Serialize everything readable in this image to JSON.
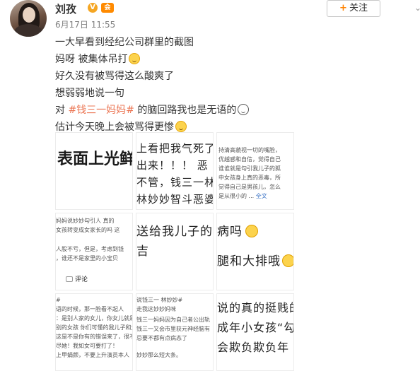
{
  "user": {
    "name": "刘孜",
    "vip_badge": "V",
    "member_badge": "会",
    "timestamp": "6月17日 11:55",
    "avatar_icon": "avatar"
  },
  "follow_button": {
    "plus": "+",
    "label": "关注"
  },
  "menu_icon": "chevron-down-icon",
  "post_lines": [
    {
      "before": "一大早看到经纪公司群里的截图",
      "tag": "",
      "after": ""
    },
    {
      "before": "妈呀 被集体吊打",
      "tag": "",
      "after": ""
    },
    {
      "before": "好久没有被骂得这么酸爽了",
      "tag": "",
      "after": ""
    },
    {
      "before": "想弱弱地说一句",
      "tag": "",
      "after": ""
    },
    {
      "before": "对 ",
      "tag": "#钱三一妈妈#",
      "after": " 的脑回路我也是无语的"
    },
    {
      "before": "估计今天晚上会被骂得更惨",
      "tag": "",
      "after": ""
    }
  ],
  "tiles": {
    "t1": {
      "line1": "表面上光鲜"
    },
    "t2": {
      "line1": "上看把我气死了",
      "line2": "出来！！！ 恶",
      "line3": "不管，钱三一林",
      "line4": "林妙妙智斗恶婆"
    },
    "t3": {
      "line1": "持清高藐视一切的嘴脸，",
      "line2": "优越感和自信，觉得自己",
      "line3": "谁谁就是勾引我儿子的狐",
      "line4": "中女孩身上真的恶毒，所",
      "line5": "觉得自己是男孩儿，怎么",
      "line6": "是从很小的 ...",
      "more": "全文"
    },
    "t4": {
      "line1": "妈妈说妙妙勾引人 真的",
      "line2": "女孩转变成女家长的吗 这",
      "line3": "人股不亏，但是，考虑到钱",
      "line4": "，谁还不是家里的小宝贝",
      "comment": "评论"
    },
    "t5": {
      "line1": "送给我儿子的",
      "line2": "吉"
    },
    "t6": {
      "line1": "病吗",
      "line2": "腿和大排哦"
    },
    "t7": {
      "line1": "#",
      "line2": "语的时候，那一脸看不起人",
      "line3": "：是别人家的女儿，你女儿就是个渣渣",
      "line4": "别的女孩 你们可懂的我儿子和女孩。名",
      "line5": "这是不是你有的错误来了，很不得让女孩妈妈后",
      "line6": "尽她！我如女可要打了！",
      "line7": "上甲娟颜，不要上升演员本人"
    },
    "t8": {
      "line1": "说钱三一 林妙妙#",
      "line2": "走我这妙妙妈咪",
      "line3": "钱三一妈妈因为自己者公出轨",
      "line4": "钱三一又会市里获元神经脑有",
      "line5": "忌要不都有点病态了",
      "line6": "妙妙那么短大条。"
    },
    "t9": {
      "line1": "说的真的挺贱的",
      "line2": "成年小女孩“勾",
      "line3": "会欺负欺负年"
    }
  }
}
